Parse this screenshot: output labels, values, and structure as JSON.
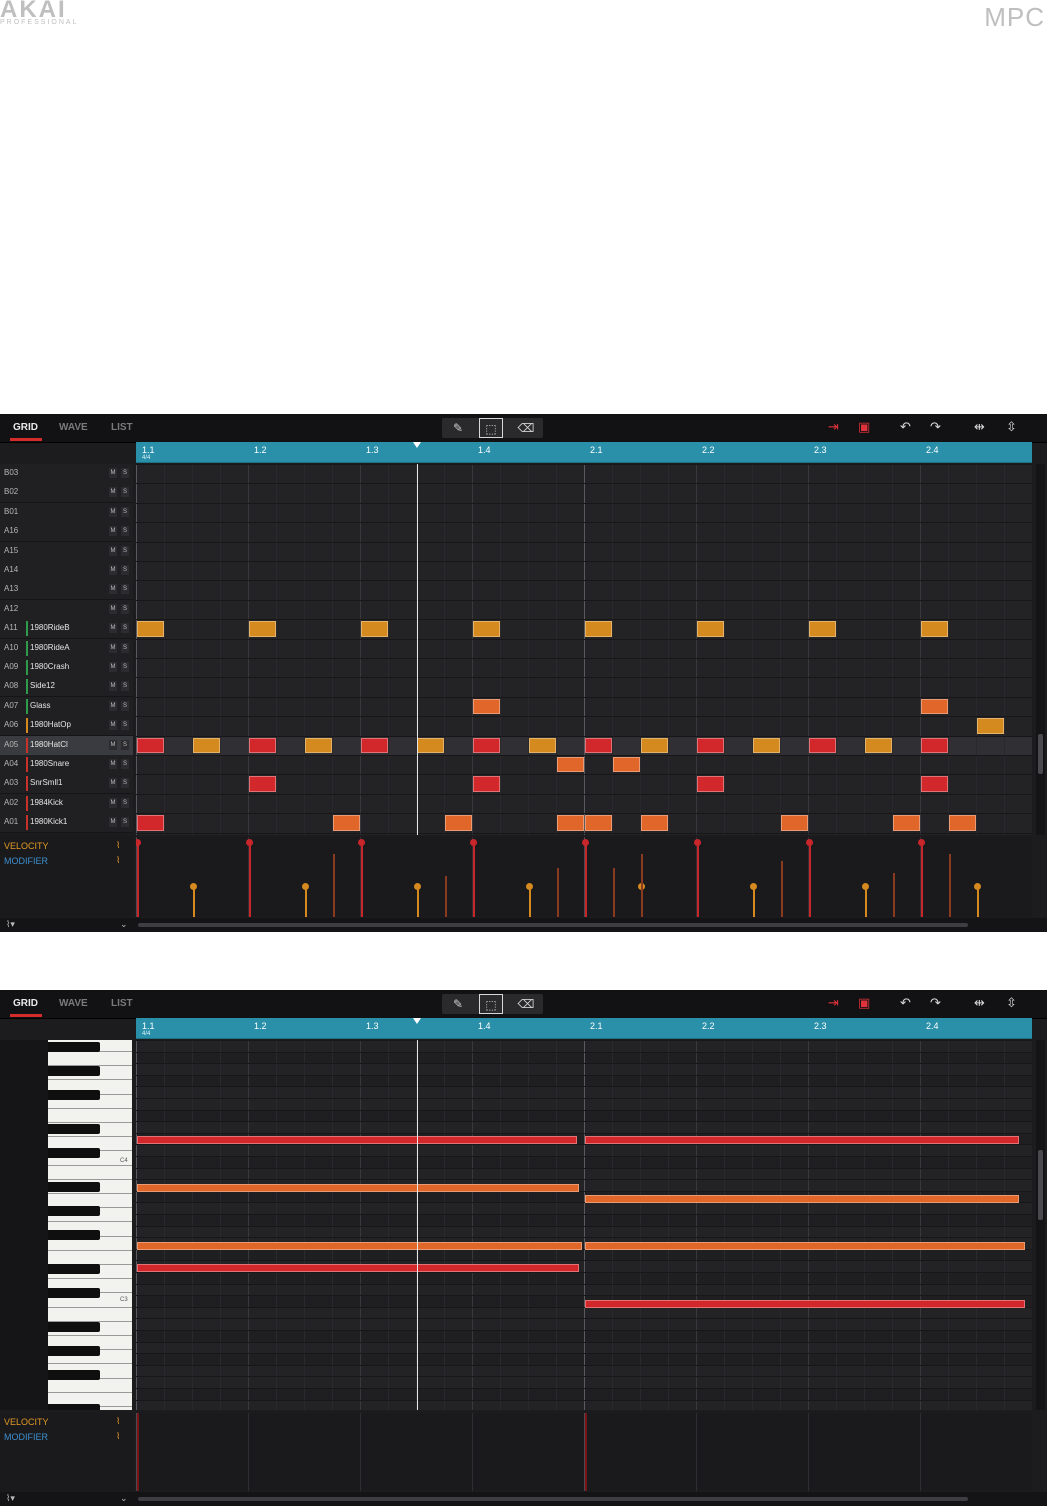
{
  "brand": {
    "maker": "AKAI",
    "maker_sub": "PROFESSIONAL",
    "product": "MPC"
  },
  "tabs": [
    {
      "label": "GRID",
      "active": true
    },
    {
      "label": "WAVE",
      "active": false
    },
    {
      "label": "LIST",
      "active": false
    }
  ],
  "tools": {
    "draw": "pencil-icon",
    "select": "marquee-select-icon",
    "erase": "eraser-icon"
  },
  "right_tools": [
    "note-follow-icon",
    "selection-box-icon",
    "undo-icon",
    "redo-icon",
    "zoom-horizontal-icon",
    "zoom-vertical-icon"
  ],
  "ruler": {
    "labels": [
      "1.1",
      "1.2",
      "1.3",
      "1.4",
      "2.1",
      "2.2",
      "2.3",
      "2.4"
    ],
    "time_signature": "4/4"
  },
  "drum_tracks": [
    {
      "id": "B03",
      "name": ""
    },
    {
      "id": "B02",
      "name": ""
    },
    {
      "id": "B01",
      "name": ""
    },
    {
      "id": "A16",
      "name": ""
    },
    {
      "id": "A15",
      "name": ""
    },
    {
      "id": "A14",
      "name": ""
    },
    {
      "id": "A13",
      "name": ""
    },
    {
      "id": "A12",
      "name": ""
    },
    {
      "id": "A11",
      "name": "1980RideB"
    },
    {
      "id": "A10",
      "name": "1980RideA"
    },
    {
      "id": "A09",
      "name": "1980Crash"
    },
    {
      "id": "A08",
      "name": "Side12"
    },
    {
      "id": "A07",
      "name": "Glass"
    },
    {
      "id": "A06",
      "name": "1980HatOp"
    },
    {
      "id": "A05",
      "name": "1980HatCl",
      "selected": true
    },
    {
      "id": "A04",
      "name": "1980Snare"
    },
    {
      "id": "A03",
      "name": "SnrSmll1"
    },
    {
      "id": "A02",
      "name": "1984Kick"
    },
    {
      "id": "A01",
      "name": "1980Kick1"
    }
  ],
  "mute_label": "M",
  "solo_label": "S",
  "drum_notes": [
    {
      "row": "A11",
      "steps": [
        0,
        4,
        8,
        12,
        16,
        20,
        24,
        28
      ]
    },
    {
      "row": "A07",
      "steps": [
        12,
        28
      ]
    },
    {
      "row": "A06",
      "steps": [
        30
      ]
    },
    {
      "row": "A05",
      "steps": [
        0,
        2,
        4,
        6,
        8,
        10,
        12,
        14,
        16,
        18,
        20,
        22,
        24,
        26,
        28
      ]
    },
    {
      "row": "A04",
      "steps": [
        15,
        17
      ]
    },
    {
      "row": "A03",
      "steps": [
        4,
        12,
        20,
        28
      ]
    },
    {
      "row": "A01",
      "steps": [
        0,
        7,
        11,
        15,
        16,
        18,
        23,
        27,
        29
      ]
    }
  ],
  "velocity_stems": [
    {
      "step": 0,
      "value": 1.0
    },
    {
      "step": 2,
      "value": 0.4
    },
    {
      "step": 4,
      "value": 1.0
    },
    {
      "step": 6,
      "value": 0.4
    },
    {
      "step": 7,
      "value": 0.85
    },
    {
      "step": 8,
      "value": 1.0
    },
    {
      "step": 10,
      "value": 0.4
    },
    {
      "step": 11,
      "value": 0.55
    },
    {
      "step": 12,
      "value": 1.0
    },
    {
      "step": 14,
      "value": 0.4
    },
    {
      "step": 15,
      "value": 0.66
    },
    {
      "step": 16,
      "value": 1.0
    },
    {
      "step": 17,
      "value": 0.66
    },
    {
      "step": 18,
      "value": 0.4
    },
    {
      "step": 18.1,
      "value": 0.85
    },
    {
      "step": 20,
      "value": 1.0
    },
    {
      "step": 22,
      "value": 0.4
    },
    {
      "step": 23,
      "value": 0.75
    },
    {
      "step": 24,
      "value": 1.0
    },
    {
      "step": 26,
      "value": 0.4
    },
    {
      "step": 27,
      "value": 0.6
    },
    {
      "step": 28,
      "value": 1.0
    },
    {
      "step": 29,
      "value": 0.85
    },
    {
      "step": 30,
      "value": 0.4
    }
  ],
  "lanes": {
    "velocity": "VELOCITY",
    "modifier": "MODIFIER"
  },
  "piano": {
    "labels": [
      "C4",
      "C3"
    ]
  },
  "piano_notes": [
    {
      "start_step": 0,
      "end_step": 15.7,
      "color": "#d2272b",
      "lane": 0
    },
    {
      "start_step": 16,
      "end_step": 31.5,
      "color": "#d2272b",
      "lane": 0
    },
    {
      "start_step": 0,
      "end_step": 15.8,
      "color": "#e0662a",
      "lane": 1
    },
    {
      "start_step": 16,
      "end_step": 31.5,
      "color": "#e0662a",
      "lane": 2
    },
    {
      "start_step": 0,
      "end_step": 15.9,
      "color": "#e0662a",
      "lane": 3
    },
    {
      "start_step": 16,
      "end_step": 31.7,
      "color": "#e0662a",
      "lane": 3
    },
    {
      "start_step": 0,
      "end_step": 15.8,
      "color": "#d2272b",
      "lane": 4
    },
    {
      "start_step": 16,
      "end_step": 31.7,
      "color": "#d2272b",
      "lane": 5
    }
  ],
  "colors": {
    "accent_red": "#d62b2b",
    "ruler": "#2a90aa",
    "note_red": "#d2272b",
    "note_orange": "#e0662a",
    "note_amber": "#d48a1e"
  }
}
